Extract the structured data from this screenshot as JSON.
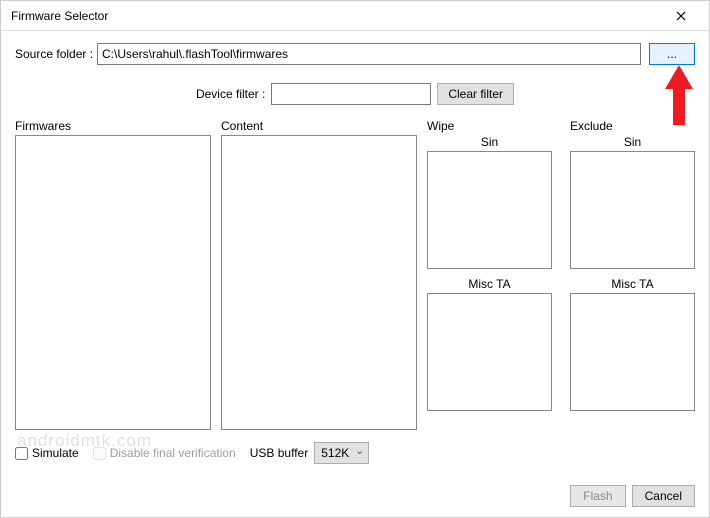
{
  "window": {
    "title": "Firmware Selector"
  },
  "source": {
    "label": "Source folder :",
    "value": "C:\\Users\\rahul\\.flashTool\\firmwares",
    "browse_label": "..."
  },
  "device_filter": {
    "label": "Device filter :",
    "value": "",
    "clear_label": "Clear filter"
  },
  "panels": {
    "firmwares_label": "Firmwares",
    "content_label": "Content",
    "wipe_label": "Wipe",
    "exclude_label": "Exclude",
    "sin_label": "Sin",
    "misc_ta_label": "Misc TA"
  },
  "options": {
    "simulate_label": "Simulate",
    "simulate_checked": false,
    "disable_verification_label": "Disable final verification",
    "disable_verification_checked": false,
    "usb_buffer_label": "USB buffer",
    "usb_buffer_value": "512K"
  },
  "actions": {
    "flash_label": "Flash",
    "cancel_label": "Cancel"
  },
  "watermark": "androidmtk.com"
}
